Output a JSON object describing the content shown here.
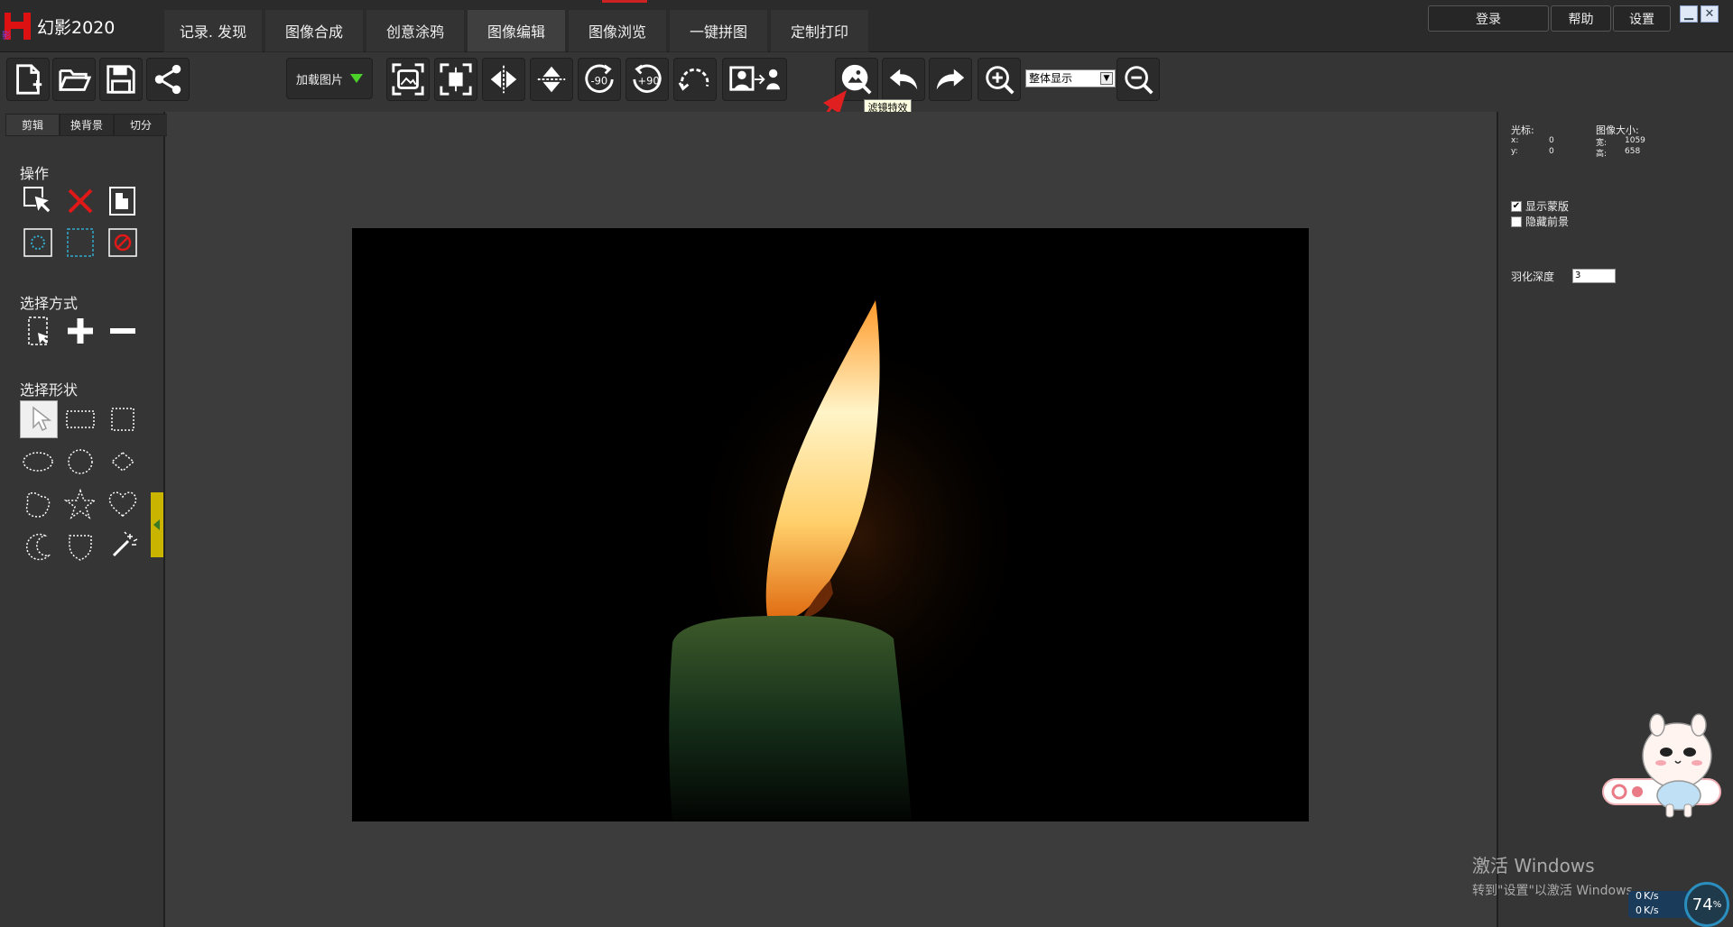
{
  "app": {
    "title": "幻影2020",
    "logo_text": "影"
  },
  "menu_tabs": [
    "记录. 发现",
    "图像合成",
    "创意涂鸦",
    "图像编辑",
    "图像浏览",
    "一键拼图",
    "定制打印"
  ],
  "top_buttons": {
    "login": "登录",
    "help": "帮助",
    "settings": "设置"
  },
  "toolbar": {
    "load_image": "加载图片",
    "zoom_mode": "整体显示",
    "tooltip": "滤镜特效"
  },
  "left_panel": {
    "subtabs": [
      "剪辑",
      "换背景",
      "切分"
    ],
    "operations_label": "操作",
    "select_mode_label": "选择方式",
    "select_shape_label": "选择形状"
  },
  "right_panel": {
    "cursor_label": "光标:",
    "x_label": "x:",
    "x_value": "0",
    "y_label": "y:",
    "y_value": "0",
    "image_size_label": "图像大小:",
    "width_label": "宽:",
    "width_value": "1059",
    "height_label": "高:",
    "height_value": "658",
    "show_mask": "显示蒙版",
    "show_mask_checked": "✔",
    "hide_foreground": "隐藏前景",
    "feather_label": "羽化深度",
    "feather_value": "3"
  },
  "watermark": {
    "line1": "激活 Windows",
    "line2": "转到\"设置\"以激活 Windows。"
  },
  "netmeter": {
    "percent": "74",
    "up": "0",
    "down": "0",
    "unit": "K/s"
  },
  "colors": {
    "accent_red": "#dd1111",
    "arrow_red": "#e02020",
    "green": "#4bd12a"
  }
}
